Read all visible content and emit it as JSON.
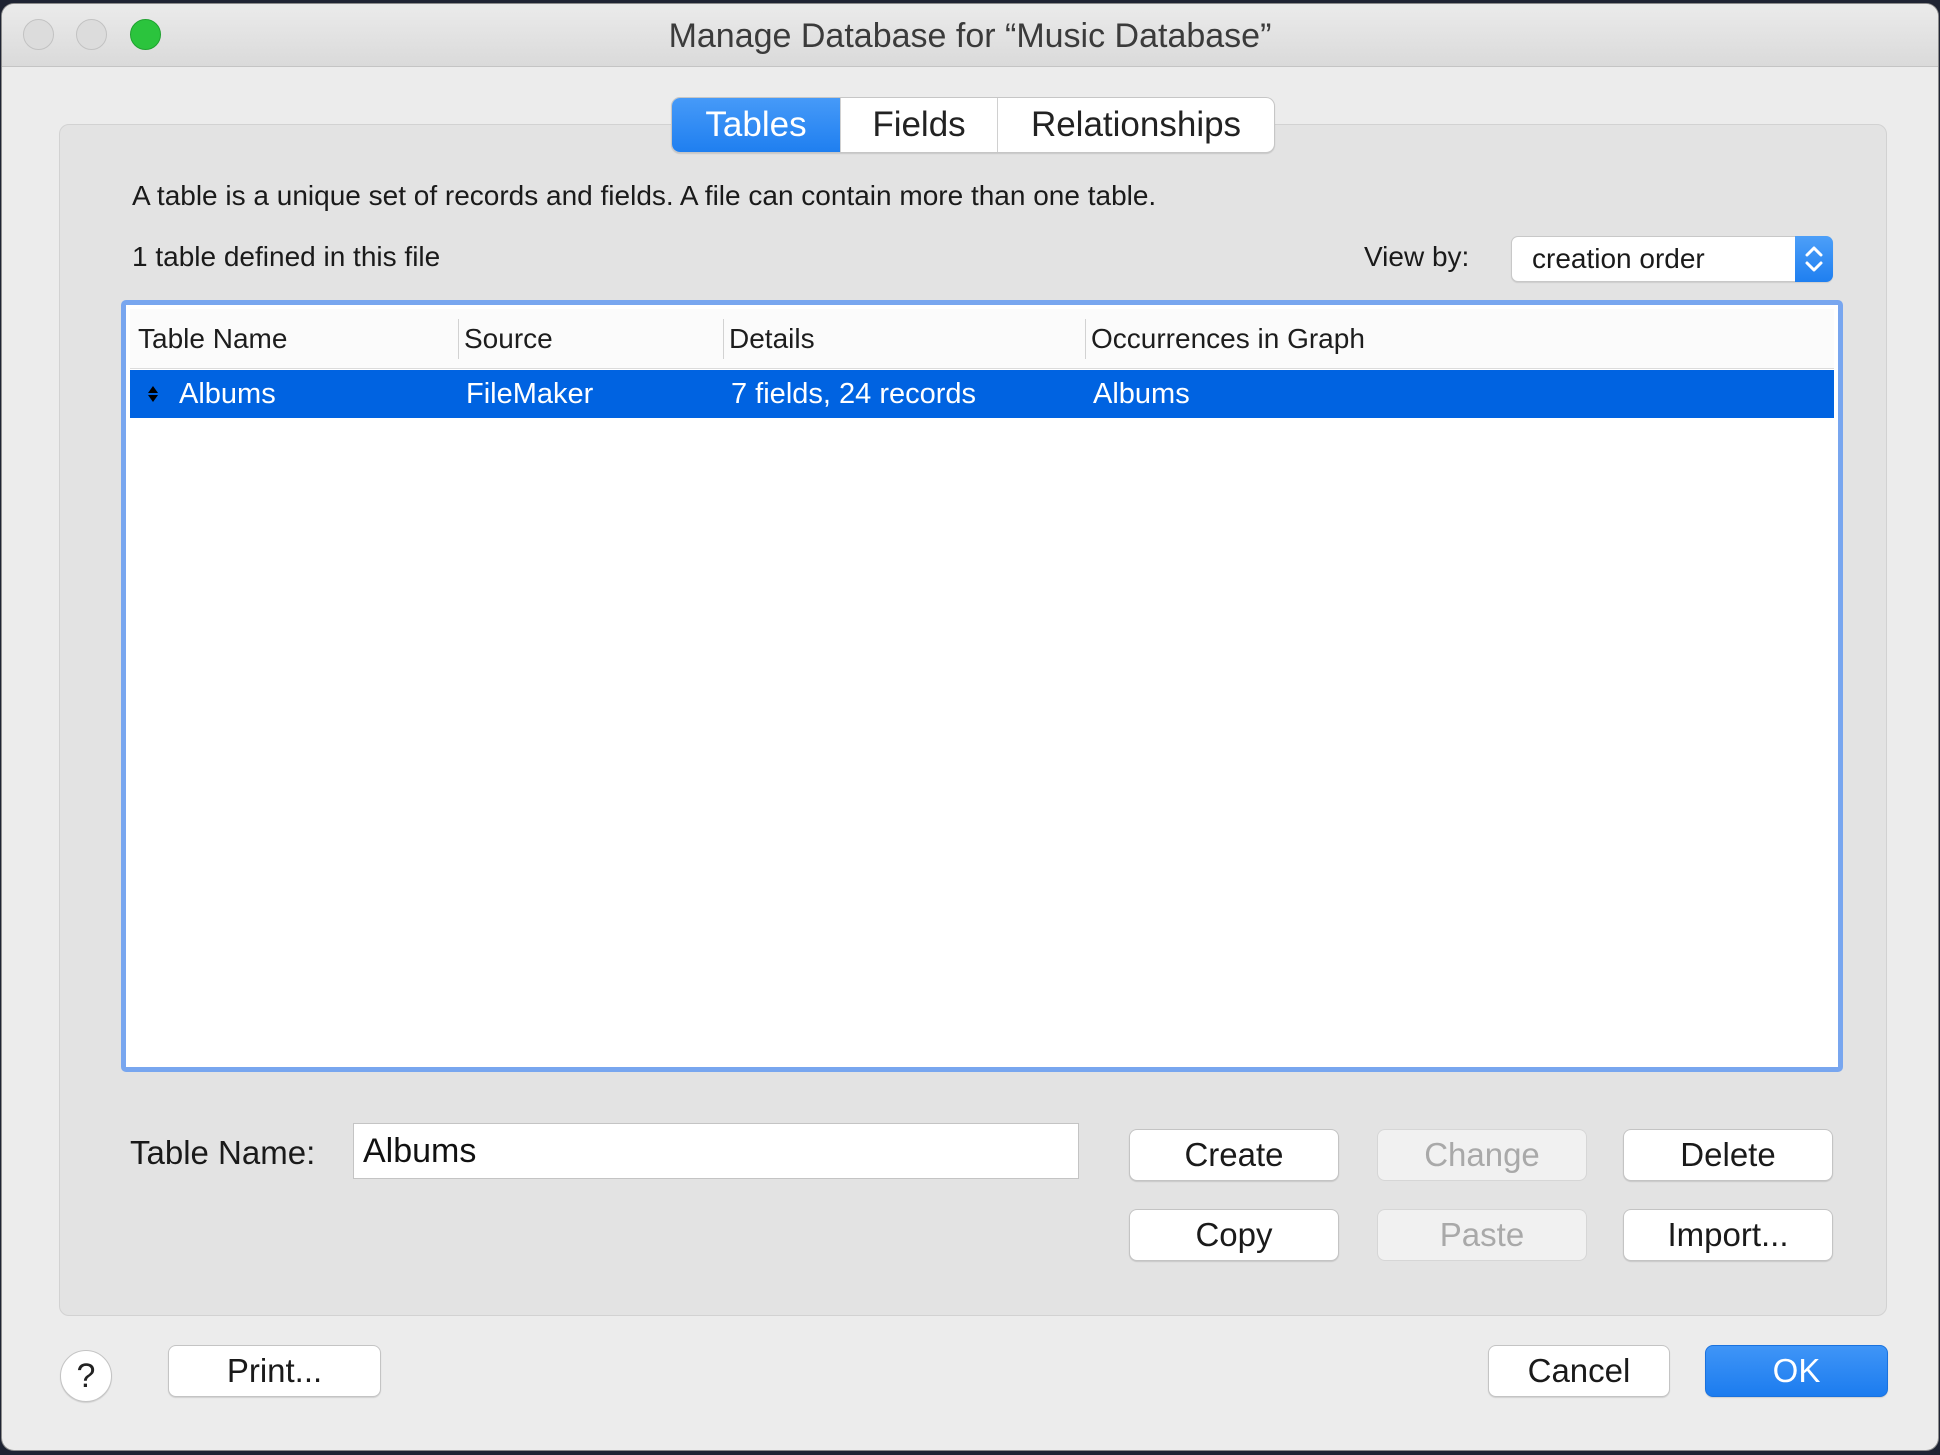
{
  "window": {
    "title": "Manage Database for “Music Database”"
  },
  "tabs": [
    {
      "label": "Tables",
      "active": true
    },
    {
      "label": "Fields",
      "active": false
    },
    {
      "label": "Relationships",
      "active": false
    }
  ],
  "description": "A table is a unique set of records and fields. A file can contain more than one table.",
  "table_count_text": "1 table defined in this file",
  "view_by": {
    "label": "View by:",
    "value": "creation order"
  },
  "table": {
    "columns": [
      "Table Name",
      "Source",
      "Details",
      "Occurrences in Graph"
    ],
    "rows": [
      {
        "name": "Albums",
        "source": "FileMaker",
        "details": "7 fields, 24 records",
        "occurrences": "Albums",
        "selected": true
      }
    ]
  },
  "editor": {
    "label": "Table Name:",
    "value": "Albums"
  },
  "actions": {
    "create": "Create",
    "change": "Change",
    "delete": "Delete",
    "copy": "Copy",
    "paste": "Paste",
    "import": "Import..."
  },
  "footer": {
    "help": "?",
    "print": "Print...",
    "cancel": "Cancel",
    "ok": "OK"
  },
  "colors": {
    "accent": "#1f7ff0",
    "selection": "#0063e1",
    "focus_ring": "#78a6ef"
  }
}
